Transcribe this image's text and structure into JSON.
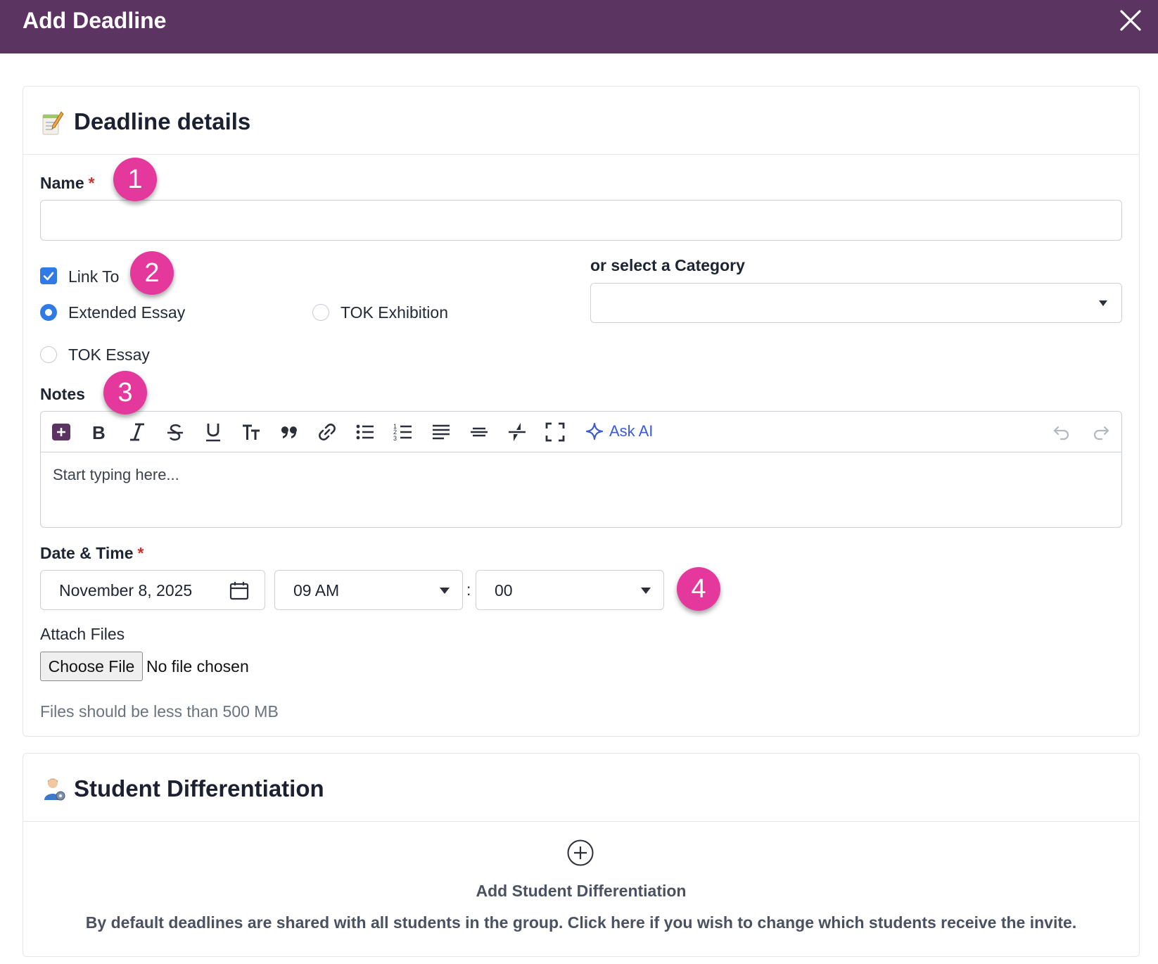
{
  "modal": {
    "title": "Add Deadline"
  },
  "details": {
    "title": "Deadline details",
    "name_label": "Name",
    "required_mark": "*",
    "name_value": "",
    "link_to_label": "Link To",
    "link_to_checked": true,
    "options": [
      "Extended Essay",
      "TOK Exhibition",
      "TOK Essay"
    ],
    "selected_option": "Extended Essay",
    "category_label": "or select a Category",
    "category_value": "",
    "notes_label": "Notes",
    "notes_placeholder": "Start typing here...",
    "ask_ai_label": "Ask AI",
    "datetime_label": "Date & Time",
    "date_value": "November 8, 2025",
    "hour_value": "09 AM",
    "time_separator": ":",
    "minute_value": "00",
    "attach_label": "Attach Files",
    "choose_file_label": "Choose File",
    "no_file_label": "No file chosen",
    "file_hint": "Files should be less than 500 MB"
  },
  "differentiation": {
    "title": "Student Differentiation",
    "add_label": "Add Student Differentiation",
    "description": "By default deadlines are shared with all students in the group. Click here if you wish to change which students receive the invite."
  },
  "annotations": [
    "1",
    "2",
    "3",
    "4"
  ],
  "colors": {
    "header": "#5c3462",
    "accent": "#2f7ae5",
    "badge": "#e5389c",
    "ai": "#3b5bdb"
  }
}
